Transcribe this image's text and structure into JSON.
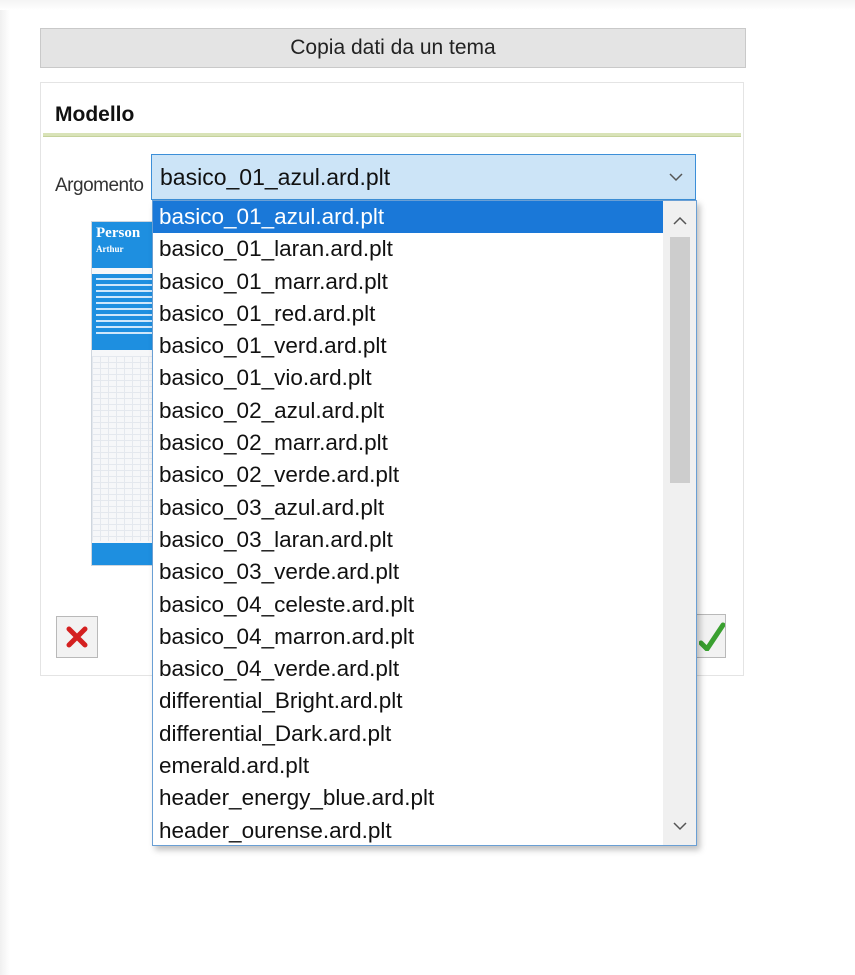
{
  "copy_button": {
    "label": "Copia dati da un tema"
  },
  "panel": {
    "title": "Modello",
    "argument_label": "Argomento"
  },
  "combo": {
    "value": "basico_01_azul.ard.plt"
  },
  "preview": {
    "title": "Person",
    "subtitle": "Arthur"
  },
  "dropdown": {
    "selected_index": 0,
    "items": [
      "basico_01_azul.ard.plt",
      "basico_01_laran.ard.plt",
      "basico_01_marr.ard.plt",
      "basico_01_red.ard.plt",
      "basico_01_verd.ard.plt",
      "basico_01_vio.ard.plt",
      "basico_02_azul.ard.plt",
      "basico_02_marr.ard.plt",
      "basico_02_verde.ard.plt",
      "basico_03_azul.ard.plt",
      "basico_03_laran.ard.plt",
      "basico_03_verde.ard.plt",
      "basico_04_celeste.ard.plt",
      "basico_04_marron.ard.plt",
      "basico_04_verde.ard.plt",
      "differential_Bright.ard.plt",
      "differential_Dark.ard.plt",
      "emerald.ard.plt",
      "header_energy_blue.ard.plt",
      "header_ourense.ard.plt"
    ]
  },
  "icons": {
    "combo_arrow": "chevron-down-icon",
    "cancel": "close-icon",
    "confirm": "check-icon",
    "scroll_up": "chevron-up-icon",
    "scroll_down": "chevron-down-icon"
  },
  "colors": {
    "selection": "#1a78d8",
    "combo_bg": "#cce4f7",
    "preview_blue": "#1e8fe0",
    "cancel_red": "#d42020",
    "confirm_green": "#3aa030"
  }
}
